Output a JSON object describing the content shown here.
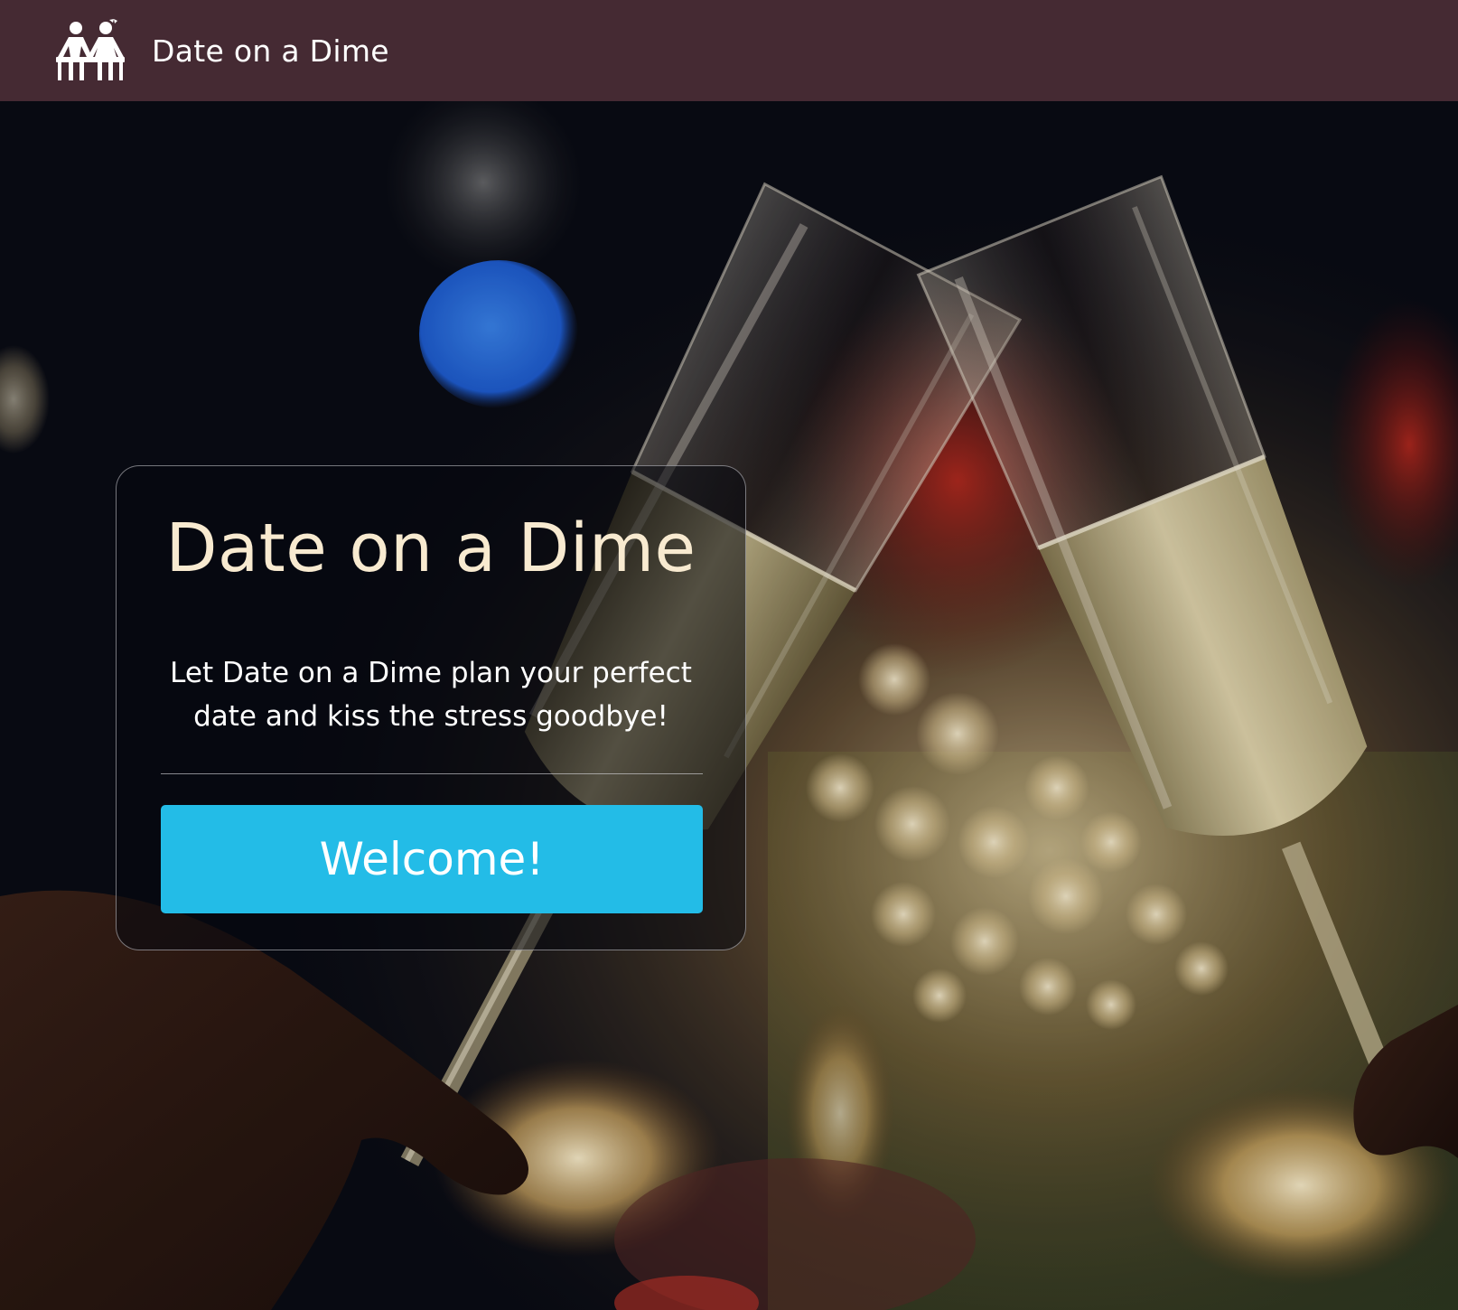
{
  "navbar": {
    "brand_name": "Date on a Dime",
    "logo_icon": "couple-on-bench-icon",
    "background_color": "#452a33"
  },
  "hero": {
    "image_subject": "champagne-toast-photo"
  },
  "card": {
    "title": "Date on a Dime",
    "tagline": "Let Date on a Dime plan your perfect date and kiss the stress goodbye!",
    "button_label": "Welcome!",
    "title_color": "#f8ead0",
    "button_color": "#23bce7"
  }
}
